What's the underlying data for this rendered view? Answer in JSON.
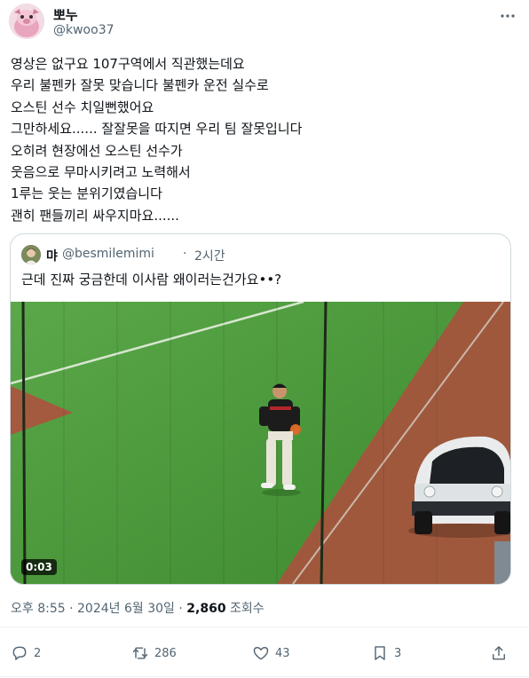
{
  "author": {
    "name": "뽀누",
    "handle": "@kwoo37"
  },
  "tweet_lines": [
    "영상은 없구요 107구역에서 직관했는데요",
    "우리 불펜카 잘못 맞습니다 불펜카 운전 실수로",
    "오스틴 선수 치일뻔했어요",
    "그만하세요...... 잘잘못을 따지면 우리 팀 잘못입니다",
    "오히려 현장에선 오스틴 선수가",
    "웃음으로 무마시키려고 노력해서",
    "1루는 웃는 분위기였습니다",
    "괜히 팬들끼리 싸우지마요......"
  ],
  "quoted": {
    "name": "먀",
    "handle": "@besmilemimi",
    "dot": "·",
    "time": "2시간",
    "text": "근데 진짜 궁금한데 이사람 왜이러는건가요••?",
    "video_duration": "0:03"
  },
  "meta": {
    "time": "오후 8:55",
    "sep1": "·",
    "date": "2024년 6월 30일",
    "sep2": "·",
    "views_count": "2,860",
    "views_label": "조회수"
  },
  "actions": {
    "replies": "2",
    "retweets": "286",
    "likes": "43",
    "bookmarks": "3"
  },
  "colors": {
    "text": "#0f1419",
    "secondary": "#536471",
    "border": "#cfd9de",
    "divider": "#eff3f4",
    "field_grass": "#4a9a3a",
    "field_dirt": "#a0583c"
  }
}
